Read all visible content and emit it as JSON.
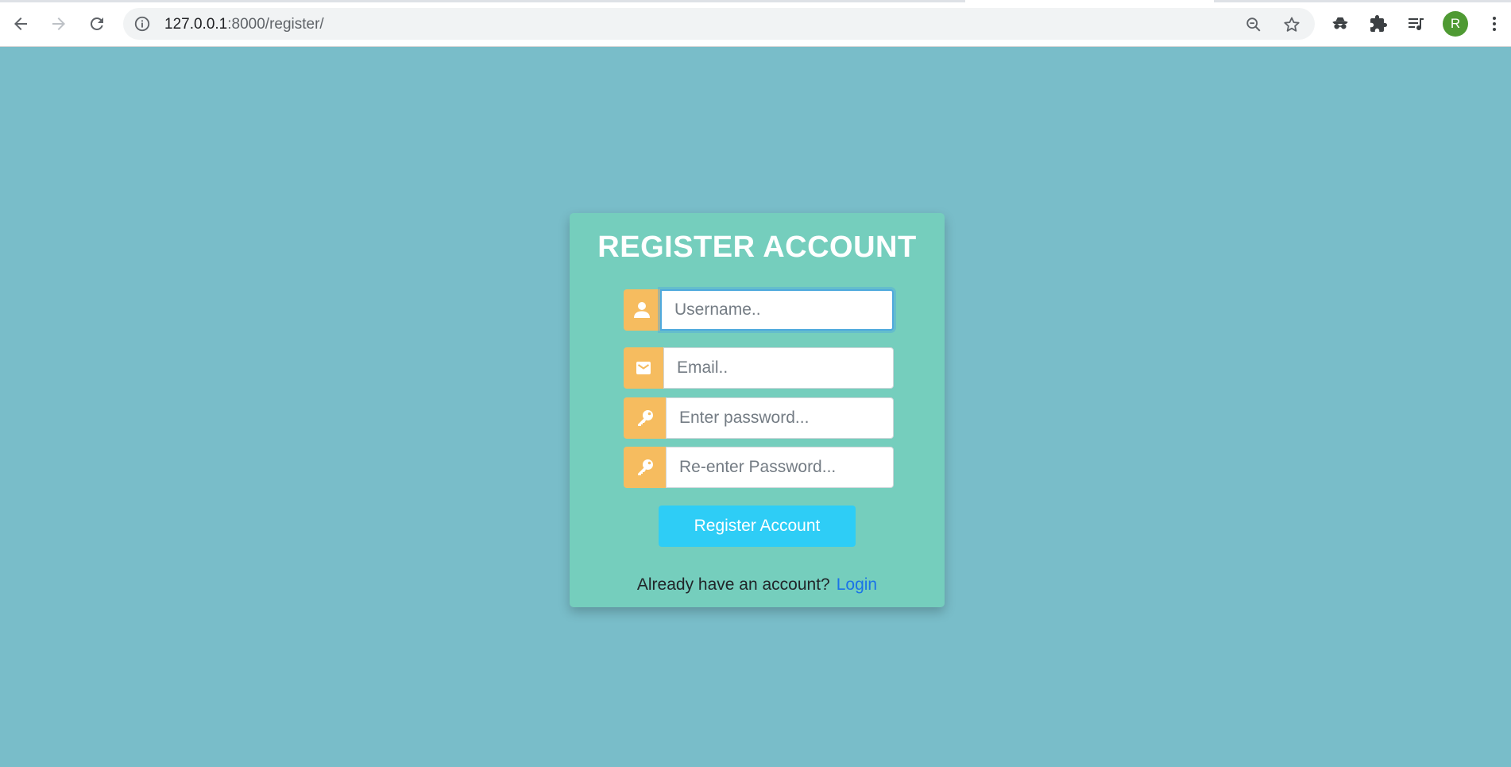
{
  "browser": {
    "url_host": "127.0.0.1",
    "url_rest": ":8000/register/",
    "profile_initial": "R"
  },
  "form": {
    "title": "REGISTER ACCOUNT",
    "username_placeholder": "Username..",
    "email_placeholder": "Email..",
    "password_placeholder": "Enter password...",
    "confirm_placeholder": "Re-enter Password...",
    "submit_label": "Register Account",
    "footer_prompt": "Already have an account?",
    "login_link": "Login"
  },
  "colors": {
    "page_background": "#79bdc9",
    "card_background": "#75cebd",
    "icon_background": "#f6bc5f",
    "button_background": "#2ecdf6",
    "link": "#1a73e8"
  }
}
